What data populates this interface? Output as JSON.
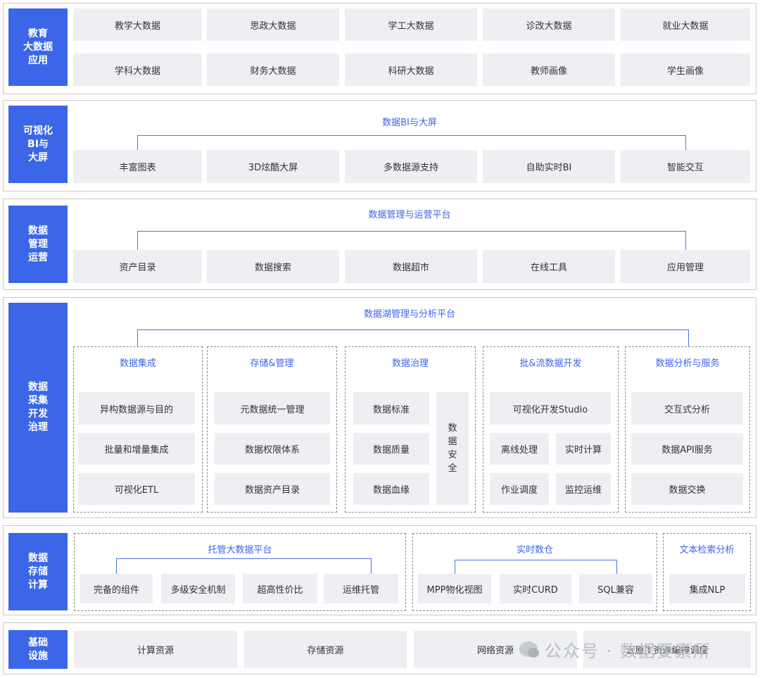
{
  "row1": {
    "side": "教育\n大数据\n应用",
    "items": [
      "教学大数据",
      "思政大数据",
      "学工大数据",
      "诊改大数据",
      "就业大数据",
      "学科大数据",
      "财务大数据",
      "科研大数据",
      "教师画像",
      "学生画像"
    ]
  },
  "row2": {
    "side": "可视化\nBI与\n大屏",
    "title": "数据BI与大屏",
    "items": [
      "丰富图表",
      "3D炫酷大屏",
      "多数据源支持",
      "自助实时BI",
      "智能交互"
    ]
  },
  "row3": {
    "side": "数据\n管理\n运营",
    "title": "数据管理与运营平台",
    "items": [
      "资产目录",
      "数据搜索",
      "数据超市",
      "在线工具",
      "应用管理"
    ]
  },
  "row4": {
    "side": "数据\n采集\n开发\n治理",
    "title": "数据湖管理与分析平台",
    "integration": {
      "title": "数据集成",
      "items": [
        "异构数据源与目的",
        "批量和增量集成",
        "可视化ETL"
      ]
    },
    "storage": {
      "title": "存储&管理",
      "items": [
        "元数据统一管理",
        "数据权限体系",
        "数据资产目录"
      ]
    },
    "governance": {
      "title": "数据治理",
      "items": [
        "数据标准",
        "数据质量",
        "数据血缘"
      ],
      "security": "数据安全"
    },
    "dev": {
      "title": "批&流数据开发",
      "studio": "可视化开发Studio",
      "items": [
        "离线处理",
        "实时计算",
        "作业调度",
        "监控运维"
      ]
    },
    "service": {
      "title": "数据分析与服务",
      "items": [
        "交互式分析",
        "数据API服务",
        "数据交换"
      ]
    }
  },
  "row5": {
    "side": "数据\n存储\n计算",
    "hosted": {
      "title": "托管大数据平台",
      "items": [
        "完备的组件",
        "多级安全机制",
        "超高性价比",
        "运维托管"
      ]
    },
    "realtime": {
      "title": "实时数仓",
      "items": [
        "MPP物化视图",
        "实时CURD",
        "SQL兼容"
      ]
    },
    "search": {
      "title": "文本检索分析",
      "items": [
        "集成NLP"
      ]
    }
  },
  "row6": {
    "side": "基础\n设施",
    "items": [
      "计算资源",
      "存储资源",
      "网络资源",
      "云原生资源编排调度"
    ]
  },
  "watermark": "公众号 · 数据要素所",
  "colors": {
    "accent": "#3b66e8",
    "box": "#eeeff3",
    "border": "#c9c9c9"
  }
}
